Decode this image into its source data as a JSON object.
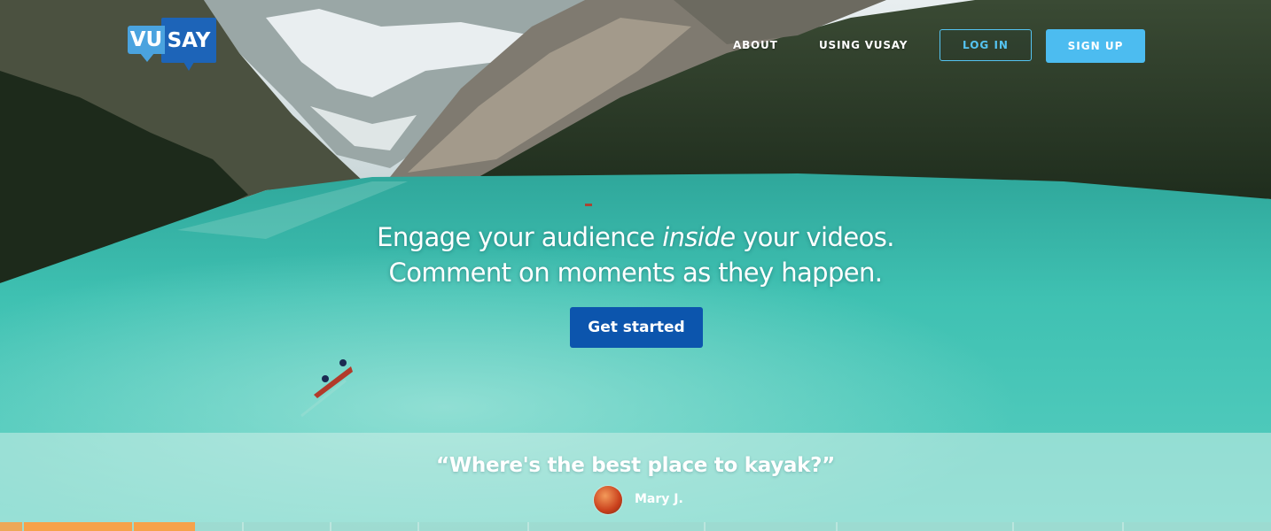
{
  "header": {
    "logo": {
      "part1": "VU",
      "part2": "SAY"
    },
    "nav": [
      {
        "label": "ABOUT"
      },
      {
        "label": "USING VUSAY"
      }
    ],
    "login_label": "LOG IN",
    "signup_label": "SIGN UP"
  },
  "hero": {
    "line1_prefix": "Engage your audience ",
    "line1_emphasis": "inside",
    "line1_suffix": " your videos.",
    "line2": "Comment on moments as they happen.",
    "cta_label": "Get started"
  },
  "testimonial": {
    "quote": "“Where's the best place to kayak?”",
    "author": "Mary J."
  },
  "colors": {
    "brand_dark_blue": "#1d64b8",
    "brand_light_blue": "#4aa3df",
    "cta_blue": "#0c55ad",
    "signup_blue": "#4cbcf0",
    "timeline_orange": "#f6a24a"
  },
  "icons": {
    "logo": "speech-bubble-logo",
    "avatar": "user-avatar"
  }
}
